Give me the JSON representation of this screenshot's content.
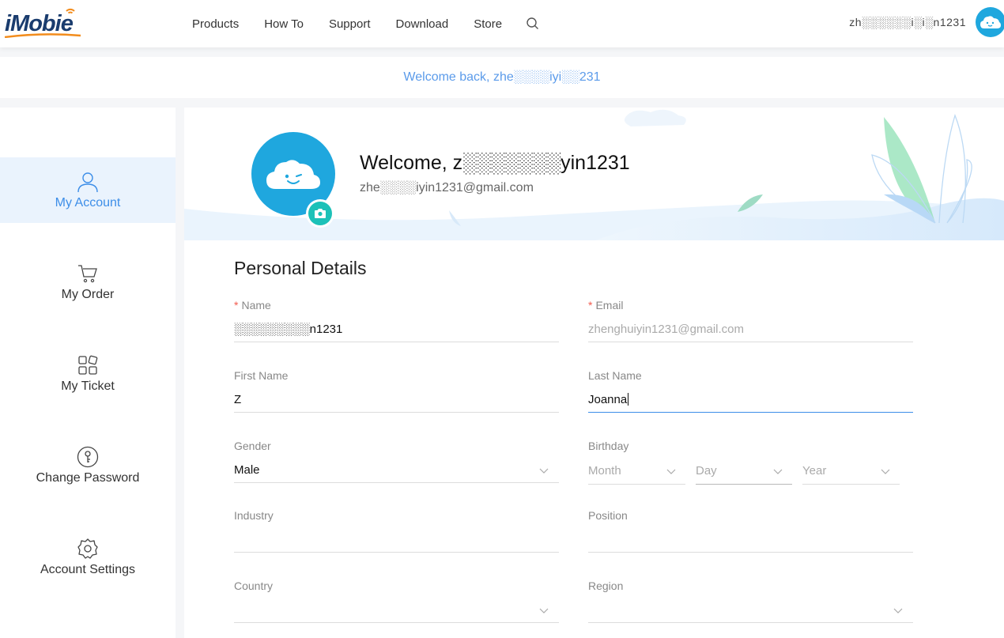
{
  "header": {
    "logo_text": "iMobie",
    "nav": [
      "Products",
      "How To",
      "Support",
      "Download",
      "Store"
    ],
    "username": "zh░░░░░░i░i░n1231"
  },
  "welcome_bar": {
    "text": "Welcome back, zhe░░░░iyi░░231"
  },
  "sidebar": {
    "items": [
      {
        "label": "My Account",
        "icon": "user-icon",
        "active": true
      },
      {
        "label": "My Order",
        "icon": "cart-icon",
        "active": false
      },
      {
        "label": "My Ticket",
        "icon": "ticket-icon",
        "active": false
      },
      {
        "label": "Change Password",
        "icon": "key-icon",
        "active": false
      },
      {
        "label": "Account Settings",
        "icon": "gear-icon",
        "active": false
      }
    ]
  },
  "profile": {
    "title": "Welcome, z░░░░░░░yin1231",
    "email": "zhe░░░░iyin1231@gmail.com"
  },
  "form": {
    "section_title": "Personal Details",
    "name": {
      "label": "Name",
      "required": true,
      "value": "░░░░░░░░░n1231"
    },
    "email": {
      "label": "Email",
      "required": true,
      "value": "zhenghuiyin1231@gmail.com"
    },
    "first_name": {
      "label": "First Name",
      "value": "Z"
    },
    "last_name": {
      "label": "Last Name",
      "value": "Joanna"
    },
    "gender": {
      "label": "Gender",
      "value": "Male"
    },
    "birthday": {
      "label": "Birthday",
      "month": "Month",
      "day": "Day",
      "year": "Year"
    },
    "industry": {
      "label": "Industry",
      "value": ""
    },
    "position": {
      "label": "Position",
      "value": ""
    },
    "country": {
      "label": "Country",
      "value": ""
    },
    "region": {
      "label": "Region",
      "value": ""
    }
  },
  "colors": {
    "accent": "#3d8ee8",
    "avatar": "#1fa7de",
    "camera": "#1cc1b8",
    "required": "#f25b4e"
  }
}
